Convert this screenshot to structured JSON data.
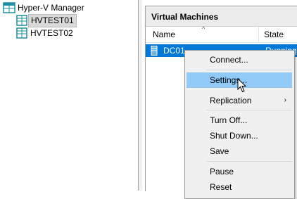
{
  "tree": {
    "root": "Hyper-V Manager",
    "hosts": [
      "HVTEST01",
      "HVTEST02"
    ],
    "selected_index": 0
  },
  "vm_panel": {
    "title": "Virtual Machines",
    "columns": [
      "Name",
      "State"
    ],
    "rows": [
      {
        "name": "DC01",
        "state": "Running"
      }
    ]
  },
  "context_menu": {
    "items": [
      {
        "label": "Connect..."
      },
      {
        "label": "Settings..."
      },
      {
        "label": "Replication",
        "submenu": true,
        "arrow": "›"
      },
      {
        "label": "Turn Off..."
      },
      {
        "label": "Shut Down..."
      },
      {
        "label": "Save"
      },
      {
        "label": "Pause"
      },
      {
        "label": "Reset"
      }
    ],
    "hovered": "Settings..."
  },
  "colors": {
    "selection": "#0078d7",
    "hover": "#91c9f7",
    "menu_bg": "#f0f0f0"
  },
  "icons": [
    "hyperv-manager-icon",
    "server-icon",
    "vm-icon",
    "cursor-icon"
  ]
}
